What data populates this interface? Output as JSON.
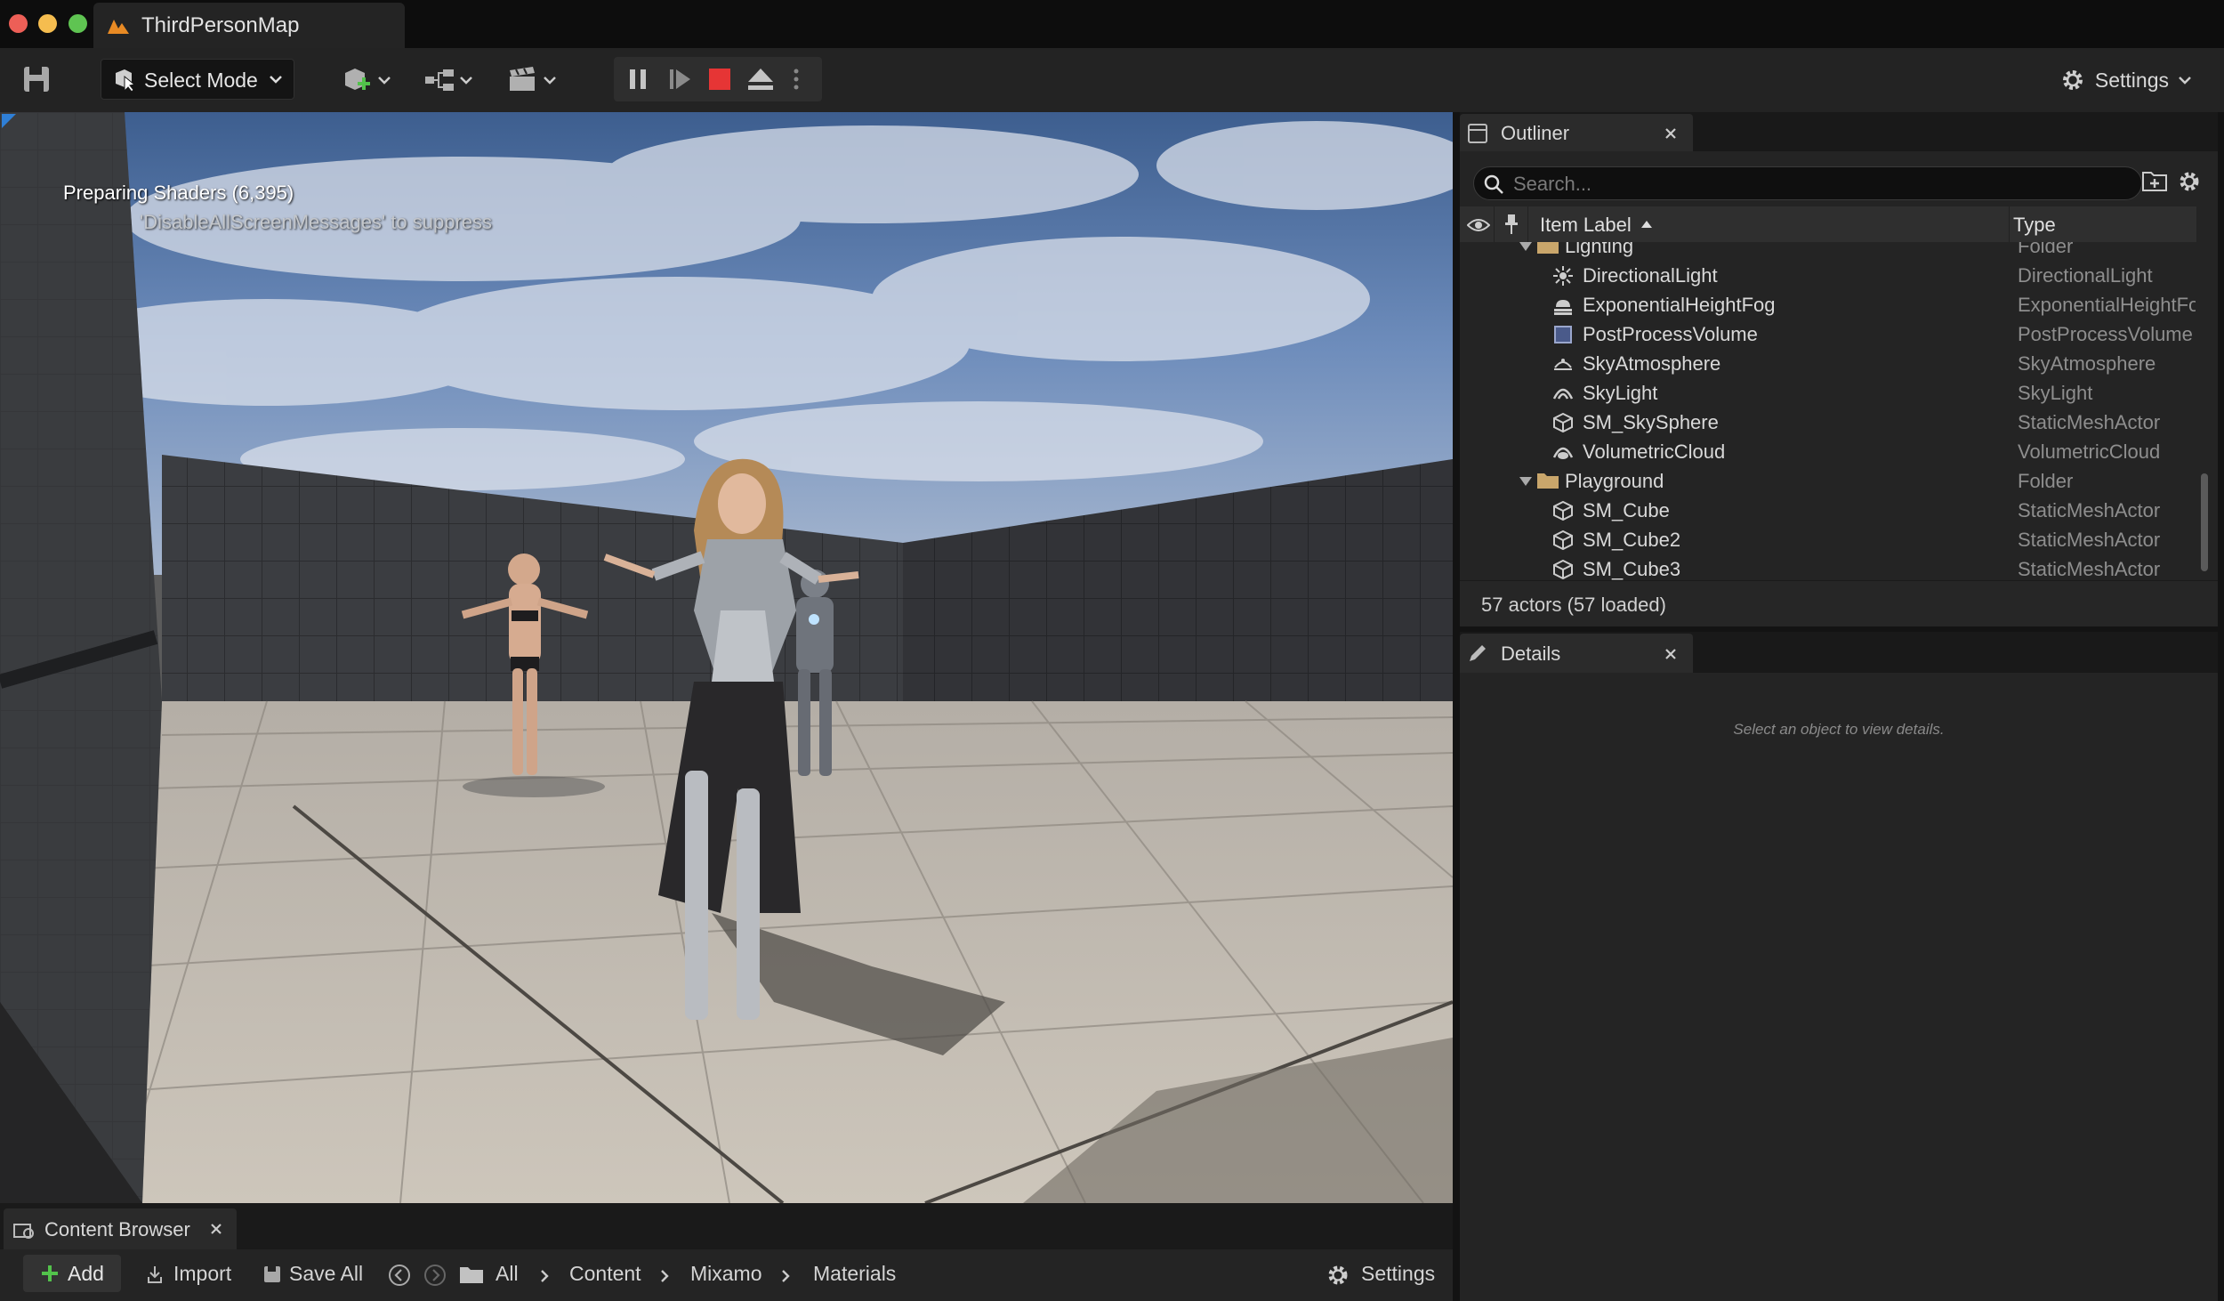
{
  "window": {
    "title": "ThirdPersonMap"
  },
  "toolbar": {
    "select_mode": "Select Mode",
    "settings": "Settings"
  },
  "viewport": {
    "message": "Preparing Shaders (6,395)",
    "hint": "'DisableAllScreenMessages' to suppress"
  },
  "outliner": {
    "tab": "Outliner",
    "search_placeholder": "Search...",
    "col_label": "Item Label",
    "col_type": "Type",
    "rows": [
      {
        "label": "Lighting",
        "type": "Folder"
      },
      {
        "label": "DirectionalLight",
        "type": "DirectionalLight"
      },
      {
        "label": "ExponentialHeightFog",
        "type": "ExponentialHeightFog"
      },
      {
        "label": "PostProcessVolume",
        "type": "PostProcessVolume"
      },
      {
        "label": "SkyAtmosphere",
        "type": "SkyAtmosphere"
      },
      {
        "label": "SkyLight",
        "type": "SkyLight"
      },
      {
        "label": "SM_SkySphere",
        "type": "StaticMeshActor"
      },
      {
        "label": "VolumetricCloud",
        "type": "VolumetricCloud"
      },
      {
        "label": "Playground",
        "type": "Folder"
      },
      {
        "label": "SM_Cube",
        "type": "StaticMeshActor"
      },
      {
        "label": "SM_Cube2",
        "type": "StaticMeshActor"
      },
      {
        "label": "SM_Cube3",
        "type": "StaticMeshActor"
      }
    ],
    "footer": "57 actors (57 loaded)"
  },
  "details": {
    "tab": "Details",
    "empty": "Select an object to view details."
  },
  "content_browser": {
    "tab": "Content Browser",
    "add": "Add",
    "import": "Import",
    "save_all": "Save All",
    "path": [
      "All",
      "Content",
      "Mixamo",
      "Materials"
    ],
    "settings": "Settings"
  },
  "colors": {
    "accent_play_stop": "#e63535",
    "folder": "#c9a66b",
    "add_green": "#52c24b"
  },
  "icons": [
    "save-icon",
    "select-mode-icon",
    "add-actor-icon",
    "blueprint-icon",
    "cinematics-icon",
    "pause-icon",
    "step-icon",
    "stop-icon",
    "eject-icon",
    "gear-icon",
    "search-icon",
    "eye-icon",
    "pin-icon",
    "folder-icon",
    "pencil-icon"
  ]
}
